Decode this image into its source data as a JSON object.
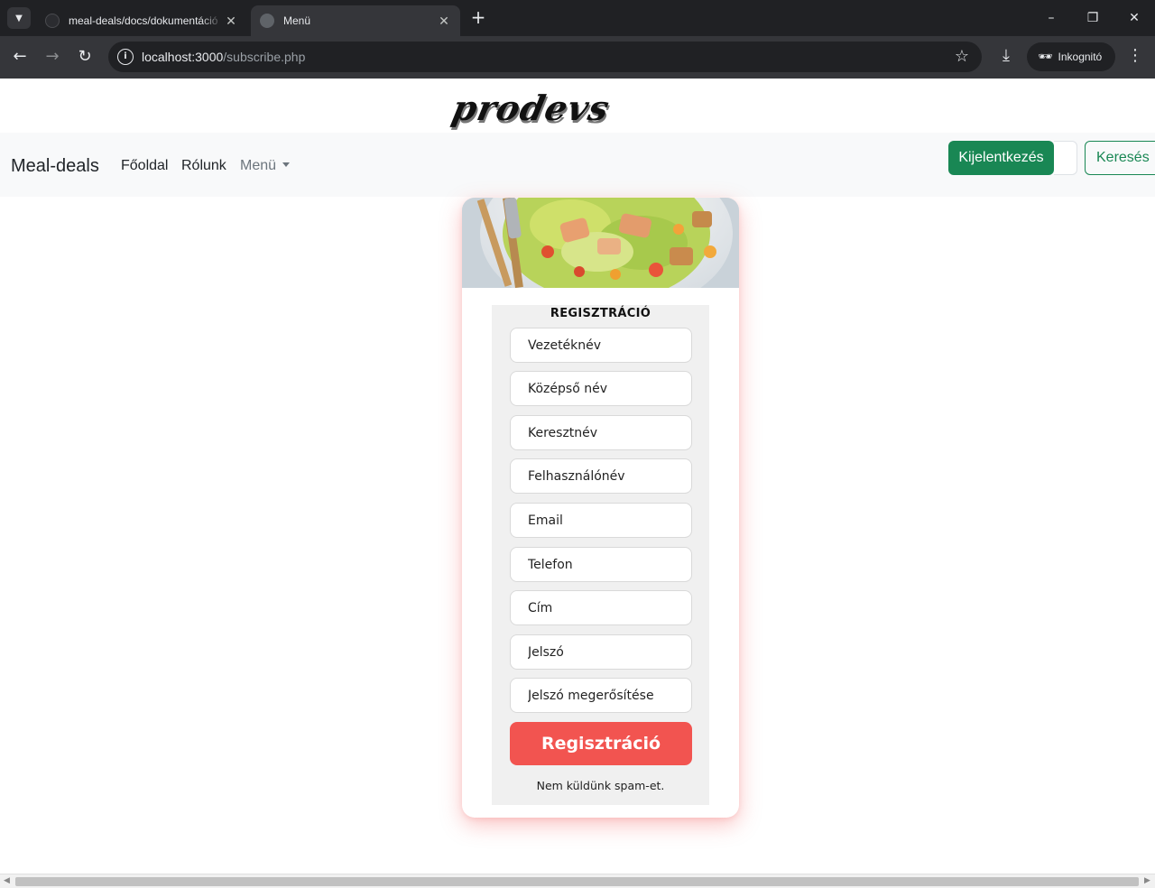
{
  "browser": {
    "tabs": [
      {
        "title": "meal-deals/docs/dokumentáció",
        "active": false
      },
      {
        "title": "Menü",
        "active": true
      }
    ],
    "url_host": "localhost:3000",
    "url_path": "/subscribe.php",
    "incognito_label": "Inkognitó",
    "icons": {
      "tab_search": "chevron-down-icon",
      "close": "close-icon",
      "new_tab": "plus-icon",
      "back": "arrow-left-icon",
      "forward": "arrow-right-icon",
      "reload": "reload-icon",
      "info": "info-icon",
      "bookmark": "star-icon",
      "download": "download-icon",
      "incognito": "incognito-icon",
      "menu": "kebab-menu-icon"
    }
  },
  "header": {
    "logo_text": "prodevs"
  },
  "navbar": {
    "brand": "Meal-deals",
    "links": [
      "Főoldal",
      "Rólunk"
    ],
    "dropdown_label": "Menü",
    "logout_button": "Kijelentkezés",
    "search_button": "Keresés",
    "search_placeholder": "",
    "colors": {
      "primary": "#198754"
    }
  },
  "form": {
    "title": "REGISZTRÁCIÓ",
    "fields": [
      "Vezetéknév",
      "Középső név",
      "Keresztnév",
      "Felhasználónév",
      "Email",
      "Telefon",
      "Cím",
      "Jelszó",
      "Jelszó megerősítése"
    ],
    "submit_label": "Regisztráció",
    "note": "Nem küldünk spam-et.",
    "colors": {
      "submit": "#f25450",
      "box": "#f0f0f0"
    }
  }
}
